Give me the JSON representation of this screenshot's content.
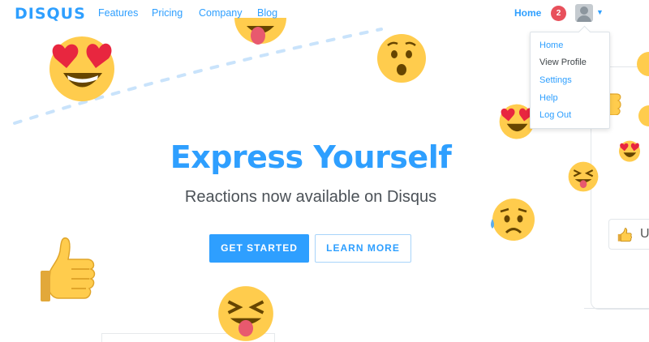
{
  "nav": {
    "logo": "DISQUS",
    "links": [
      "Features",
      "Pricing",
      "Company",
      "Blog"
    ],
    "home": "Home",
    "notification_count": "2"
  },
  "dropdown": {
    "items": [
      "Home",
      "View Profile",
      "Settings",
      "Help",
      "Log Out"
    ]
  },
  "hero": {
    "title": "Express Yourself",
    "subtitle": "Reactions now available on Disqus",
    "primary_button": "GET STARTED",
    "secondary_button": "LEARN MORE"
  },
  "device": {
    "reaction_button_text": "U"
  },
  "colors": {
    "brand": "#2e9fff",
    "badge": "#e8505b",
    "emoji_yellow": "#ffcc4d"
  }
}
